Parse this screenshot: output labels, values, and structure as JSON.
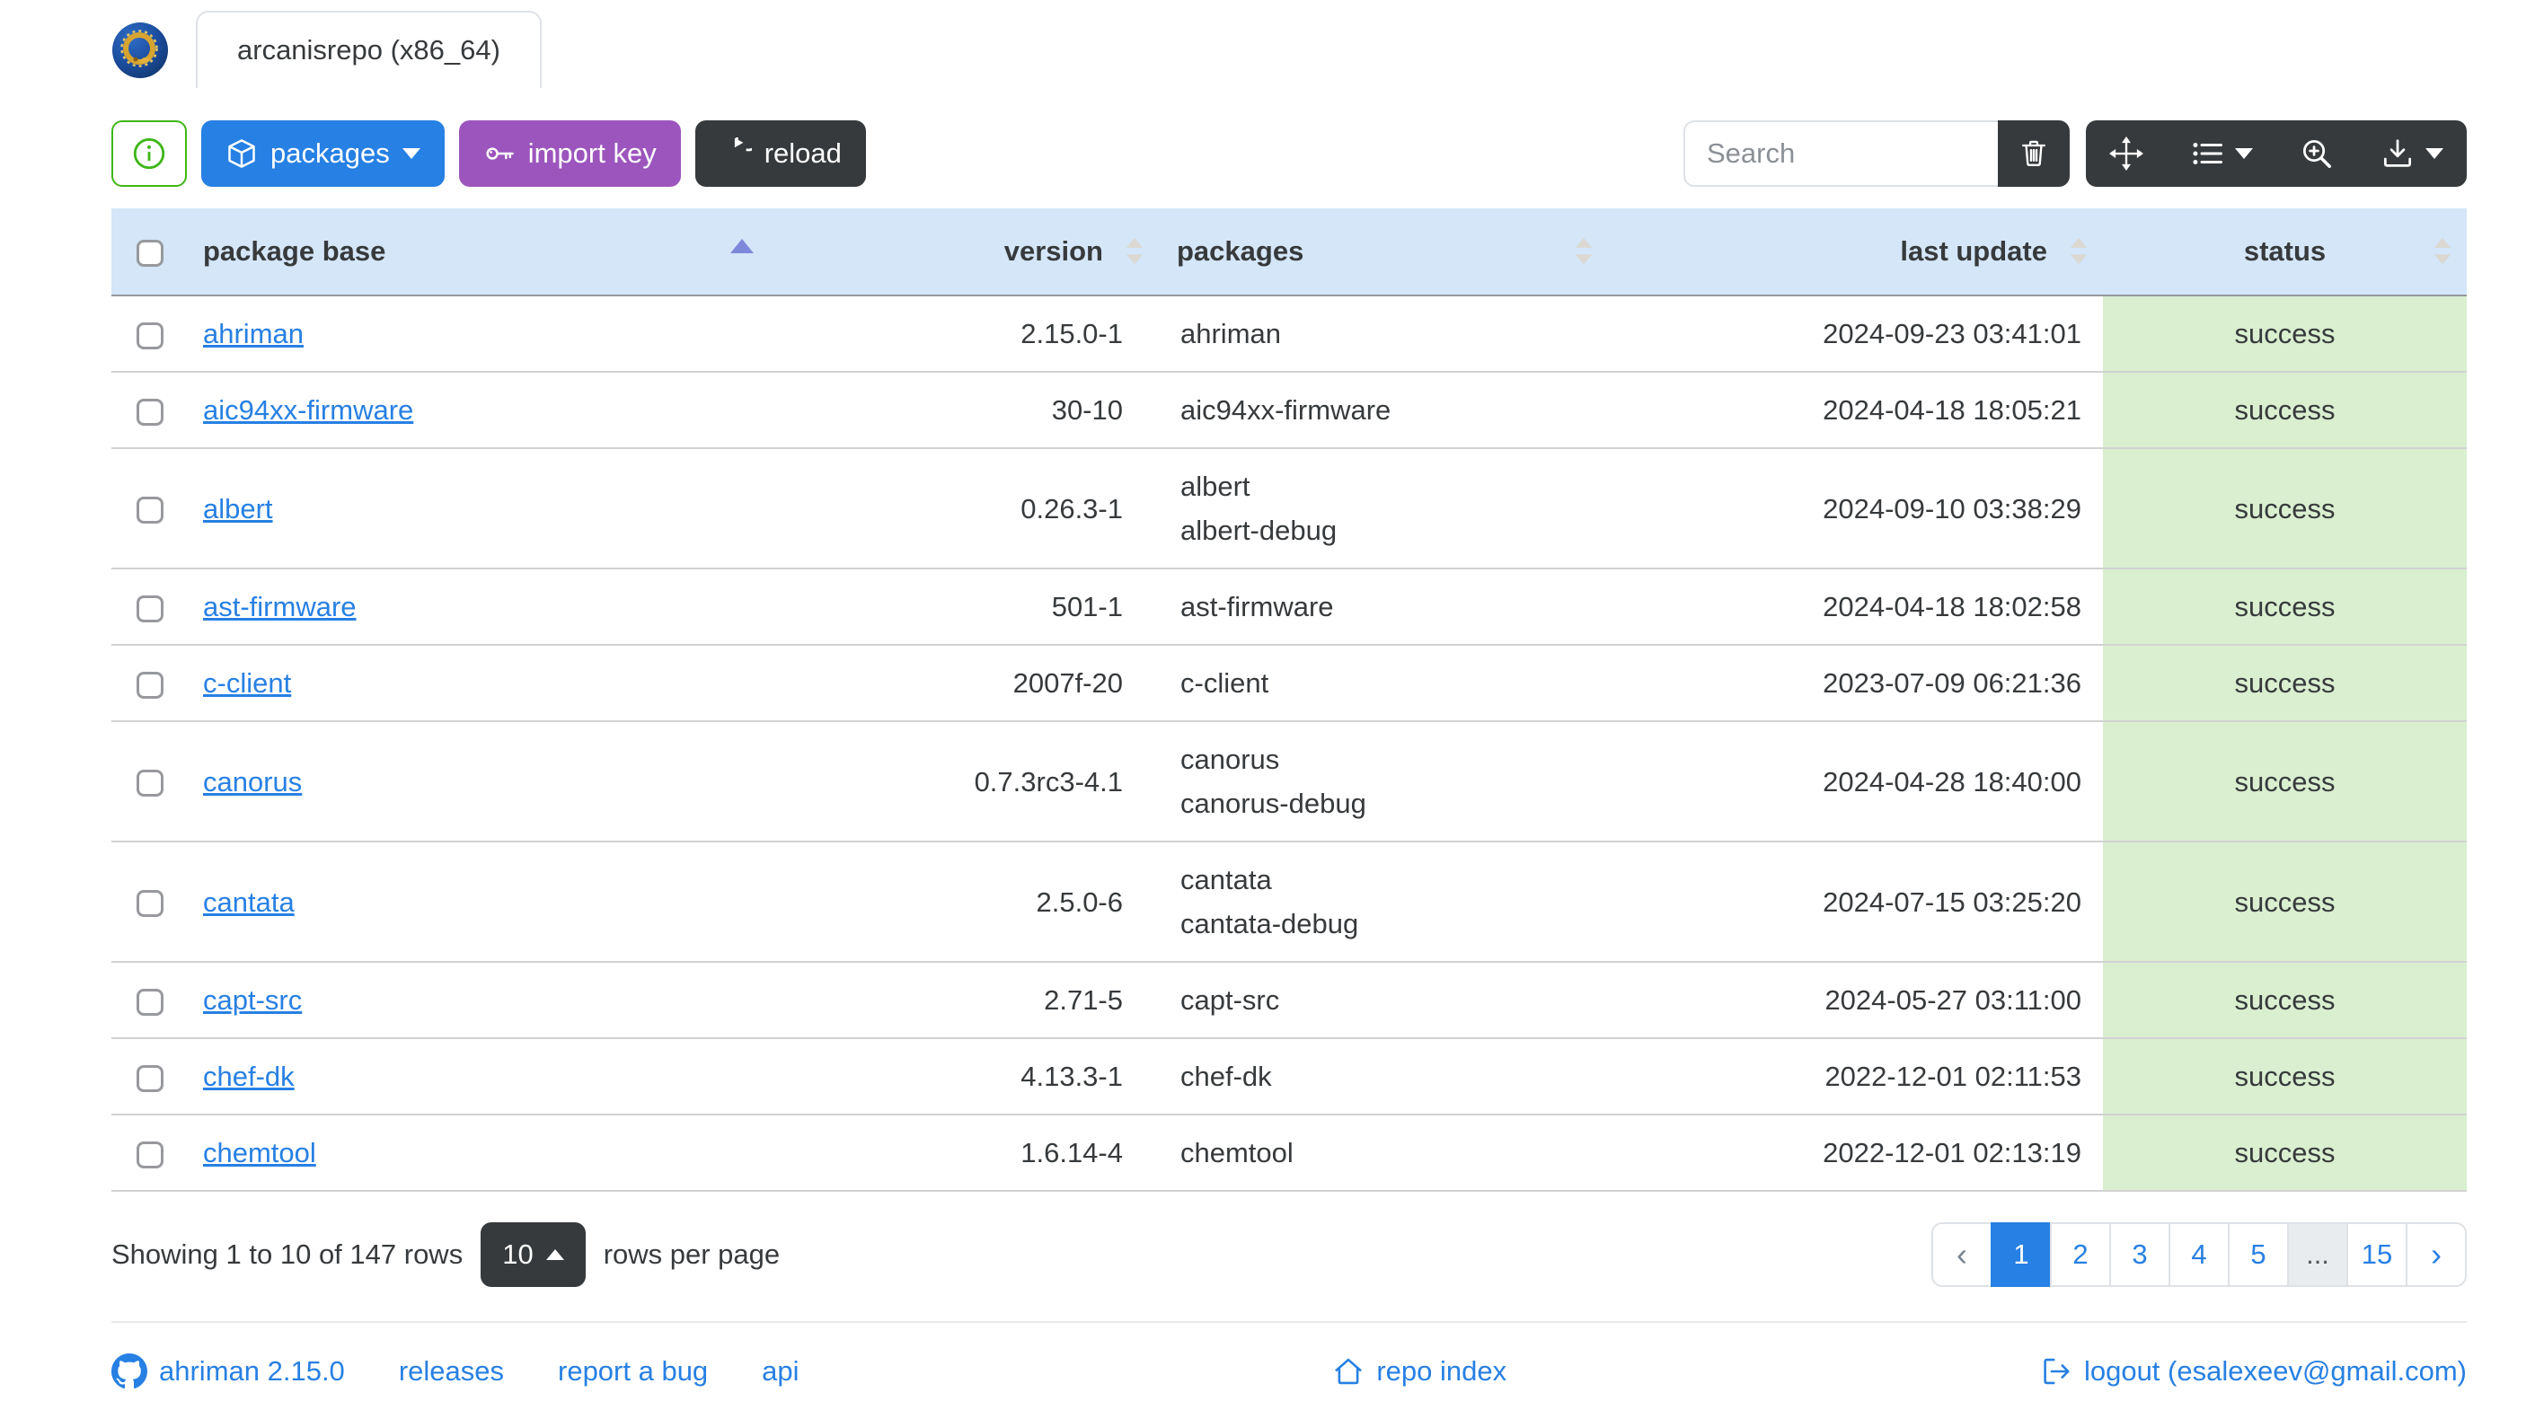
{
  "colors": {
    "primary": "#2780e3",
    "secondary": "#373a3c",
    "success": "#3fb618",
    "info_purple": "#9c55bd",
    "header_bg": "#d4e6f8",
    "success_bg": "#d9efd0",
    "link": "#2780e3",
    "sort_active": "#7d88da",
    "sort_inactive": "#dbd8d2",
    "border": "#dee2e6",
    "row_border": "#d2d2d2",
    "text": "#373a3c",
    "muted": "#8b9096"
  },
  "header": {
    "tab_label": "arcanisrepo (x86_64)",
    "logo_icon": "ahriman-dragon-logo"
  },
  "toolbar": {
    "info_icon": "info-circle-icon",
    "packages_label": "packages",
    "import_key_label": "import key",
    "reload_label": "reload",
    "search_placeholder": "Search",
    "icons": [
      "trash-icon",
      "arrows-move-icon",
      "list-columns-icon",
      "zoom-in-icon",
      "download-icon"
    ]
  },
  "table": {
    "columns": [
      {
        "label": "package base",
        "sort": "asc"
      },
      {
        "label": "version",
        "sort": "none"
      },
      {
        "label": "packages",
        "sort": "none"
      },
      {
        "label": "last update",
        "sort": "none"
      },
      {
        "label": "status",
        "sort": "none"
      }
    ],
    "rows": [
      {
        "base": "ahriman",
        "version": "2.15.0-1",
        "packages": [
          "ahriman"
        ],
        "last_update": "2024-09-23 03:41:01",
        "status": "success"
      },
      {
        "base": "aic94xx-firmware",
        "version": "30-10",
        "packages": [
          "aic94xx-firmware"
        ],
        "last_update": "2024-04-18 18:05:21",
        "status": "success"
      },
      {
        "base": "albert",
        "version": "0.26.3-1",
        "packages": [
          "albert",
          "albert-debug"
        ],
        "last_update": "2024-09-10 03:38:29",
        "status": "success"
      },
      {
        "base": "ast-firmware",
        "version": "501-1",
        "packages": [
          "ast-firmware"
        ],
        "last_update": "2024-04-18 18:02:58",
        "status": "success"
      },
      {
        "base": "c-client",
        "version": "2007f-20",
        "packages": [
          "c-client"
        ],
        "last_update": "2023-07-09 06:21:36",
        "status": "success"
      },
      {
        "base": "canorus",
        "version": "0.7.3rc3-4.1",
        "packages": [
          "canorus",
          "canorus-debug"
        ],
        "last_update": "2024-04-28 18:40:00",
        "status": "success"
      },
      {
        "base": "cantata",
        "version": "2.5.0-6",
        "packages": [
          "cantata",
          "cantata-debug"
        ],
        "last_update": "2024-07-15 03:25:20",
        "status": "success"
      },
      {
        "base": "capt-src",
        "version": "2.71-5",
        "packages": [
          "capt-src"
        ],
        "last_update": "2024-05-27 03:11:00",
        "status": "success"
      },
      {
        "base": "chef-dk",
        "version": "4.13.3-1",
        "packages": [
          "chef-dk"
        ],
        "last_update": "2022-12-01 02:11:53",
        "status": "success"
      },
      {
        "base": "chemtool",
        "version": "1.6.14-4",
        "packages": [
          "chemtool"
        ],
        "last_update": "2022-12-01 02:13:19",
        "status": "success"
      }
    ]
  },
  "pagination": {
    "summary": "Showing 1 to 10 of 147 rows",
    "page_size": "10",
    "rows_per_page": "rows per page",
    "prev": "‹",
    "next": "›",
    "pages": [
      "1",
      "2",
      "3",
      "4",
      "5",
      "...",
      "15"
    ],
    "active": "1"
  },
  "footer": {
    "app_version": "ahriman 2.15.0",
    "releases": "releases",
    "report_bug": "report a bug",
    "api": "api",
    "repo_index": "repo index",
    "logout": "logout (esalexeev@gmail.com)"
  }
}
